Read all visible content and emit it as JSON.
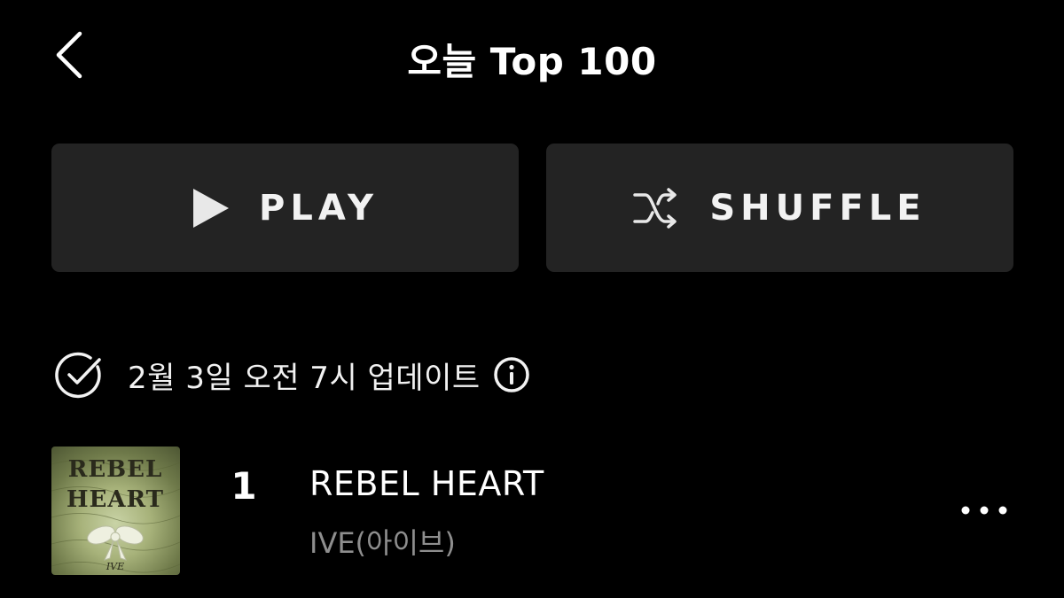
{
  "header": {
    "title": "오늘 Top 100",
    "back_icon": "chevron-left-icon"
  },
  "actions": {
    "play_label": "PLAY",
    "play_icon": "play-icon",
    "shuffle_label": "SHUFFLE",
    "shuffle_icon": "shuffle-icon"
  },
  "update": {
    "text": "2월 3일 오전 7시 업데이트",
    "check_icon": "check-circle-icon",
    "info_icon": "info-icon"
  },
  "tracks": [
    {
      "rank": "1",
      "title": "REBEL HEART",
      "artist": "IVE(아이브)",
      "album_art_text": [
        "REBEL",
        "HEART",
        "IVE"
      ],
      "more_icon": "more-horizontal-icon"
    }
  ],
  "colors": {
    "background": "#000000",
    "button_bg": "#232323",
    "primary_text": "#ffffff",
    "secondary_text": "#8e8e8e"
  }
}
